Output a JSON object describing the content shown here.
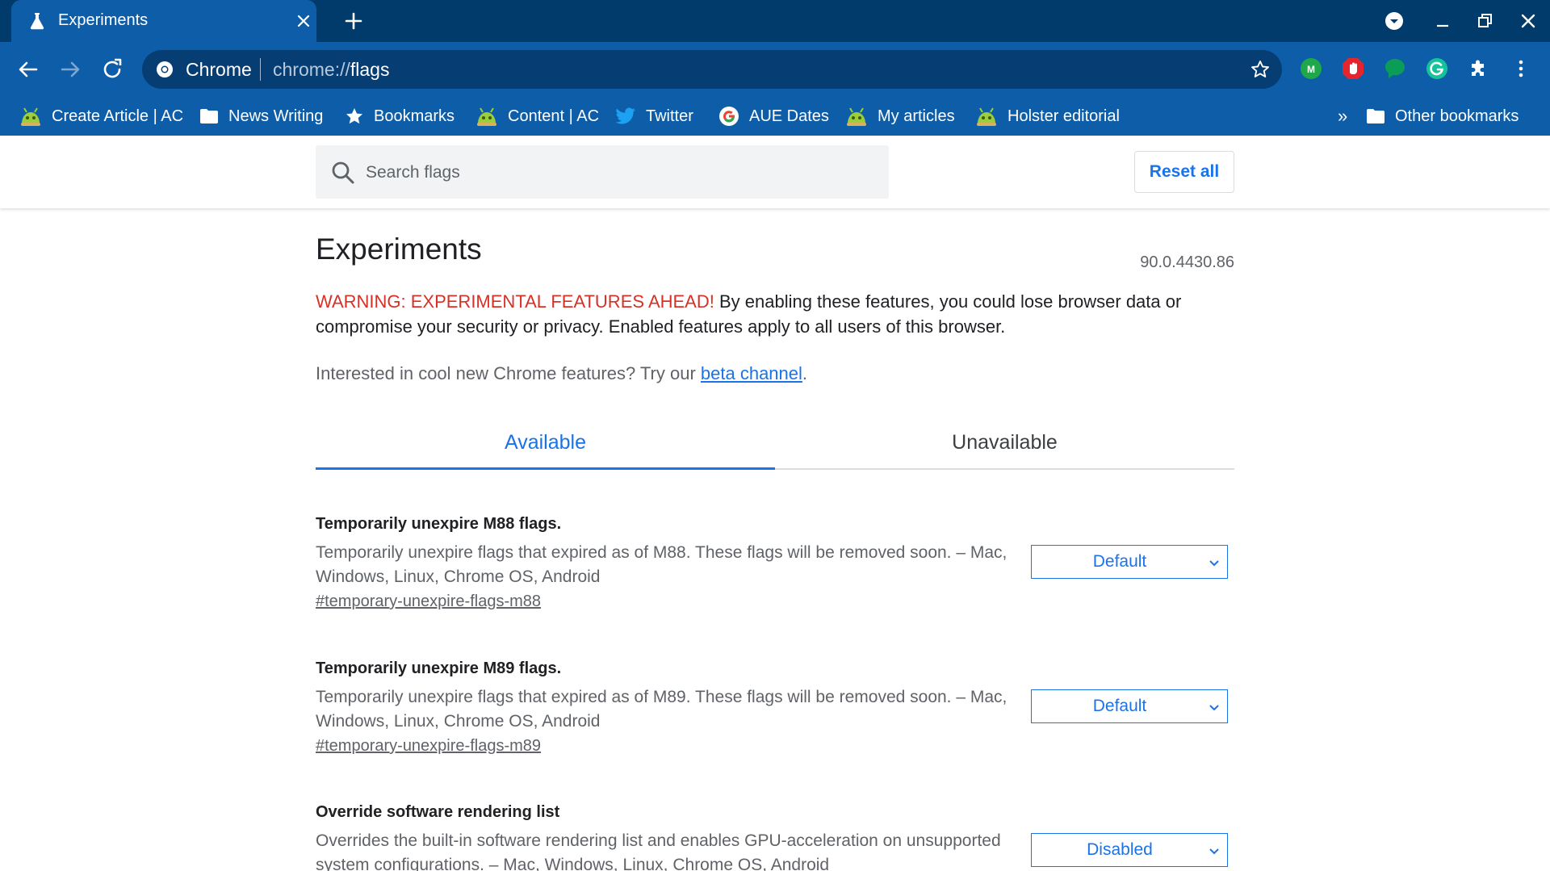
{
  "tab": {
    "title": "Experiments"
  },
  "omnibox": {
    "site_label": "Chrome",
    "url_scheme": "chrome://",
    "url_host": "flags"
  },
  "bookmarks": [
    {
      "label": "Create Article | AC",
      "icon": "android-icon"
    },
    {
      "label": "News Writing",
      "icon": "folder-icon"
    },
    {
      "label": "Bookmarks",
      "icon": "star-icon"
    },
    {
      "label": "Content | AC",
      "icon": "android-icon"
    },
    {
      "label": "Twitter",
      "icon": "twitter-icon"
    },
    {
      "label": "AUE Dates",
      "icon": "google-icon"
    },
    {
      "label": "My articles",
      "icon": "android-icon"
    },
    {
      "label": "Holster editorial",
      "icon": "android-icon"
    }
  ],
  "bookmarks_overflow": "»",
  "other_bookmarks": "Other bookmarks",
  "search": {
    "placeholder": "Search flags"
  },
  "reset_label": "Reset all",
  "page": {
    "title": "Experiments",
    "version": "90.0.4430.86",
    "warning_red": "WARNING: EXPERIMENTAL FEATURES AHEAD!",
    "warning_text": " By enabling these features, you could lose browser data or compromise your security or privacy. Enabled features apply to all users of this browser.",
    "promo_prefix": "Interested in cool new Chrome features? Try our ",
    "promo_link": "beta channel",
    "promo_suffix": "."
  },
  "tabs": {
    "available": "Available",
    "unavailable": "Unavailable"
  },
  "flags": [
    {
      "name": "Temporarily unexpire M88 flags.",
      "description": "Temporarily unexpire flags that expired as of M88. These flags will be removed soon. – Mac, Windows, Linux, Chrome OS, Android",
      "link": "#temporary-unexpire-flags-m88",
      "value": "Default"
    },
    {
      "name": "Temporarily unexpire M89 flags.",
      "description": "Temporarily unexpire flags that expired as of M89. These flags will be removed soon. – Mac, Windows, Linux, Chrome OS, Android",
      "link": "#temporary-unexpire-flags-m89",
      "value": "Default"
    },
    {
      "name": "Override software rendering list",
      "description": "Overrides the built-in software rendering list and enables GPU-acceleration on unsupported system configurations. – Mac, Windows, Linux, Chrome OS, Android",
      "link": "",
      "value": "Disabled"
    }
  ],
  "colors": {
    "tabstrip": "#003b6b",
    "toolbar": "#0d5da8",
    "accent": "#1a73e8",
    "warning": "#d93025"
  }
}
